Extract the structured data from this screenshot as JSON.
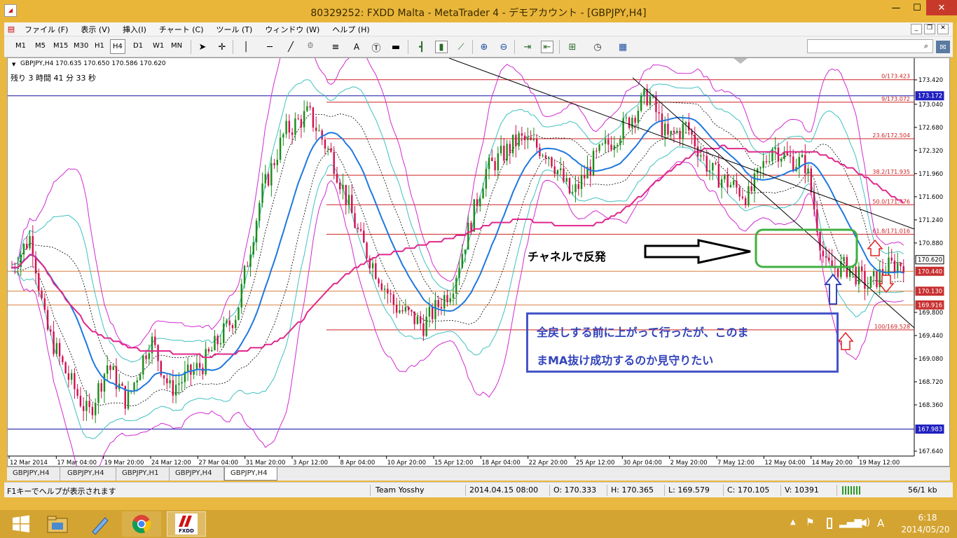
{
  "window": {
    "title": "80329252: FXDD Malta - MetaTrader 4 - デモアカウント - [GBPJPY,H4]",
    "minimize": "—",
    "maximize": "☐",
    "close": "✕"
  },
  "menu": [
    "ファイル (F)",
    "表示 (V)",
    "挿入(I)",
    "チャート (C)",
    "ツール (T)",
    "ウィンドウ (W)",
    "ヘルプ (H)"
  ],
  "toolbar": {
    "timeframes": [
      "M1",
      "M5",
      "M15",
      "M30",
      "H1",
      "H4",
      "D1",
      "W1",
      "MN"
    ],
    "active_timeframe": "H4",
    "text_tool": "A"
  },
  "chart": {
    "header": "GBPJPY,H4  170.635 170.650 170.586 170.620",
    "countdown": "残り 3 時間 41 分 33 秒",
    "price_labels": [
      {
        "text": "173.420",
        "price": 173.42
      },
      {
        "text": "173.040",
        "price": 173.04
      },
      {
        "text": "172.680",
        "price": 172.68
      },
      {
        "text": "172.320",
        "price": 172.32
      },
      {
        "text": "171.960",
        "price": 171.96
      },
      {
        "text": "171.600",
        "price": 171.6
      },
      {
        "text": "171.240",
        "price": 171.24
      },
      {
        "text": "170.880",
        "price": 170.88
      },
      {
        "text": "169.800",
        "price": 169.8
      },
      {
        "text": "169.440",
        "price": 169.44
      },
      {
        "text": "169.080",
        "price": 169.08
      },
      {
        "text": "168.720",
        "price": 168.72
      },
      {
        "text": "168.360",
        "price": 168.36
      },
      {
        "text": "167.640",
        "price": 167.64
      }
    ],
    "highlight_prices": [
      {
        "text": "173.172",
        "price": 173.172,
        "color": "#2020c0"
      },
      {
        "text": "170.620",
        "price": 170.62,
        "color": "#ffffff"
      },
      {
        "text": "170.440",
        "price": 170.44,
        "color": "#c83030"
      },
      {
        "text": "170.130",
        "price": 170.13,
        "color": "#c83030"
      },
      {
        "text": "169.916",
        "price": 169.916,
        "color": "#c83030"
      },
      {
        "text": "167.983",
        "price": 167.983,
        "color": "#2020c0"
      }
    ],
    "fib_levels": [
      {
        "text": "0/173.423",
        "price": 173.423
      },
      {
        "text": "9/173.072",
        "price": 173.072
      },
      {
        "text": "23.6/172.504",
        "price": 172.504
      },
      {
        "text": "38.2/171.935",
        "price": 171.935
      },
      {
        "text": "50.0/171.476",
        "price": 171.476
      },
      {
        "text": "61.8/171.016",
        "price": 171.016
      },
      {
        "text": "100/169.528",
        "price": 169.528
      }
    ],
    "dates": [
      "12 Mar 2014",
      "17 Mar 04:00",
      "19 Mar 20:00",
      "24 Mar 12:00",
      "27 Mar 04:00",
      "31 Mar 20:00",
      "3 Apr 12:00",
      "8 Apr 04:00",
      "10 Apr 20:00",
      "15 Apr 12:00",
      "18 Apr 04:00",
      "22 Apr 20:00",
      "25 Apr 12:00",
      "30 Apr 04:00",
      "2 May 20:00",
      "7 May 12:00",
      "12 May 04:00",
      "14 May 20:00",
      "19 May 12:00"
    ],
    "annotation_arrow_text": "チャネルで反発",
    "callout_line1": "全戻しする前に上がって行ったが、このま",
    "callout_line2": "まMA抜け成功するのか見守りたい",
    "colors": {
      "bollinger": "#d02ad0",
      "bollinger_inner": "#40c0c0",
      "ma": "#1e78e0",
      "slow_ma": "#e0288c",
      "bull": "#1a8c1a",
      "bear": "#d01050",
      "fib": "#cc2020",
      "channel": "#000000",
      "annotation_box": "#40b040",
      "callout_border": "#4455c8"
    }
  },
  "tabs": [
    "GBPJPY,H4",
    "GBPJPY,H4",
    "GBPJPY,H1",
    "GBPJPY,H4",
    "GBPJPY,H4"
  ],
  "active_tab": 4,
  "status": {
    "help": "F1キーでヘルプが表示されます",
    "profile": "Team Yosshy",
    "time": "2014.04.15 08:00",
    "open": "O: 170.333",
    "high": "H: 170.365",
    "low": "L: 169.579",
    "close": "C: 170.105",
    "volume": "V: 10391",
    "traffic": "56/1 kb"
  },
  "taskbar": {
    "time": "6:18",
    "date": "2014/05/20",
    "ime": "A",
    "fxdd_label": "FXDD"
  }
}
